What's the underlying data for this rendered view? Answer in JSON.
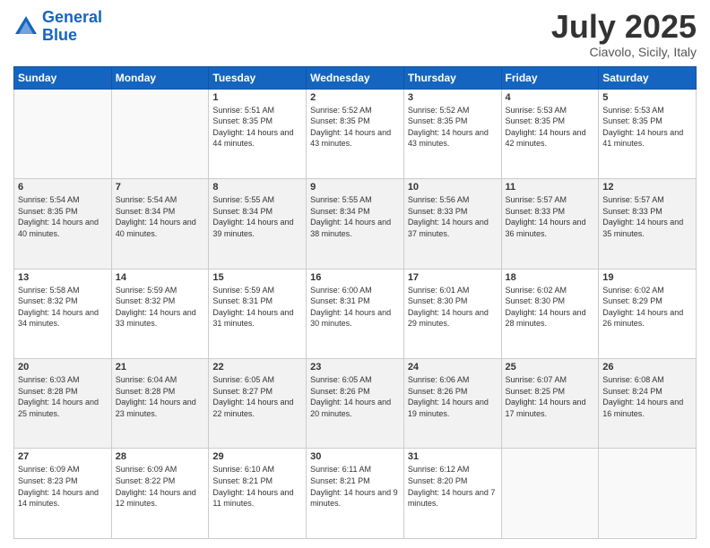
{
  "logo": {
    "line1": "General",
    "line2": "Blue"
  },
  "header": {
    "month": "July 2025",
    "location": "Ciavolo, Sicily, Italy"
  },
  "weekdays": [
    "Sunday",
    "Monday",
    "Tuesday",
    "Wednesday",
    "Thursday",
    "Friday",
    "Saturday"
  ],
  "weeks": [
    [
      {
        "day": "",
        "sunrise": "",
        "sunset": "",
        "daylight": ""
      },
      {
        "day": "",
        "sunrise": "",
        "sunset": "",
        "daylight": ""
      },
      {
        "day": "1",
        "sunrise": "Sunrise: 5:51 AM",
        "sunset": "Sunset: 8:35 PM",
        "daylight": "Daylight: 14 hours and 44 minutes."
      },
      {
        "day": "2",
        "sunrise": "Sunrise: 5:52 AM",
        "sunset": "Sunset: 8:35 PM",
        "daylight": "Daylight: 14 hours and 43 minutes."
      },
      {
        "day": "3",
        "sunrise": "Sunrise: 5:52 AM",
        "sunset": "Sunset: 8:35 PM",
        "daylight": "Daylight: 14 hours and 43 minutes."
      },
      {
        "day": "4",
        "sunrise": "Sunrise: 5:53 AM",
        "sunset": "Sunset: 8:35 PM",
        "daylight": "Daylight: 14 hours and 42 minutes."
      },
      {
        "day": "5",
        "sunrise": "Sunrise: 5:53 AM",
        "sunset": "Sunset: 8:35 PM",
        "daylight": "Daylight: 14 hours and 41 minutes."
      }
    ],
    [
      {
        "day": "6",
        "sunrise": "Sunrise: 5:54 AM",
        "sunset": "Sunset: 8:35 PM",
        "daylight": "Daylight: 14 hours and 40 minutes."
      },
      {
        "day": "7",
        "sunrise": "Sunrise: 5:54 AM",
        "sunset": "Sunset: 8:34 PM",
        "daylight": "Daylight: 14 hours and 40 minutes."
      },
      {
        "day": "8",
        "sunrise": "Sunrise: 5:55 AM",
        "sunset": "Sunset: 8:34 PM",
        "daylight": "Daylight: 14 hours and 39 minutes."
      },
      {
        "day": "9",
        "sunrise": "Sunrise: 5:55 AM",
        "sunset": "Sunset: 8:34 PM",
        "daylight": "Daylight: 14 hours and 38 minutes."
      },
      {
        "day": "10",
        "sunrise": "Sunrise: 5:56 AM",
        "sunset": "Sunset: 8:33 PM",
        "daylight": "Daylight: 14 hours and 37 minutes."
      },
      {
        "day": "11",
        "sunrise": "Sunrise: 5:57 AM",
        "sunset": "Sunset: 8:33 PM",
        "daylight": "Daylight: 14 hours and 36 minutes."
      },
      {
        "day": "12",
        "sunrise": "Sunrise: 5:57 AM",
        "sunset": "Sunset: 8:33 PM",
        "daylight": "Daylight: 14 hours and 35 minutes."
      }
    ],
    [
      {
        "day": "13",
        "sunrise": "Sunrise: 5:58 AM",
        "sunset": "Sunset: 8:32 PM",
        "daylight": "Daylight: 14 hours and 34 minutes."
      },
      {
        "day": "14",
        "sunrise": "Sunrise: 5:59 AM",
        "sunset": "Sunset: 8:32 PM",
        "daylight": "Daylight: 14 hours and 33 minutes."
      },
      {
        "day": "15",
        "sunrise": "Sunrise: 5:59 AM",
        "sunset": "Sunset: 8:31 PM",
        "daylight": "Daylight: 14 hours and 31 minutes."
      },
      {
        "day": "16",
        "sunrise": "Sunrise: 6:00 AM",
        "sunset": "Sunset: 8:31 PM",
        "daylight": "Daylight: 14 hours and 30 minutes."
      },
      {
        "day": "17",
        "sunrise": "Sunrise: 6:01 AM",
        "sunset": "Sunset: 8:30 PM",
        "daylight": "Daylight: 14 hours and 29 minutes."
      },
      {
        "day": "18",
        "sunrise": "Sunrise: 6:02 AM",
        "sunset": "Sunset: 8:30 PM",
        "daylight": "Daylight: 14 hours and 28 minutes."
      },
      {
        "day": "19",
        "sunrise": "Sunrise: 6:02 AM",
        "sunset": "Sunset: 8:29 PM",
        "daylight": "Daylight: 14 hours and 26 minutes."
      }
    ],
    [
      {
        "day": "20",
        "sunrise": "Sunrise: 6:03 AM",
        "sunset": "Sunset: 8:28 PM",
        "daylight": "Daylight: 14 hours and 25 minutes."
      },
      {
        "day": "21",
        "sunrise": "Sunrise: 6:04 AM",
        "sunset": "Sunset: 8:28 PM",
        "daylight": "Daylight: 14 hours and 23 minutes."
      },
      {
        "day": "22",
        "sunrise": "Sunrise: 6:05 AM",
        "sunset": "Sunset: 8:27 PM",
        "daylight": "Daylight: 14 hours and 22 minutes."
      },
      {
        "day": "23",
        "sunrise": "Sunrise: 6:05 AM",
        "sunset": "Sunset: 8:26 PM",
        "daylight": "Daylight: 14 hours and 20 minutes."
      },
      {
        "day": "24",
        "sunrise": "Sunrise: 6:06 AM",
        "sunset": "Sunset: 8:26 PM",
        "daylight": "Daylight: 14 hours and 19 minutes."
      },
      {
        "day": "25",
        "sunrise": "Sunrise: 6:07 AM",
        "sunset": "Sunset: 8:25 PM",
        "daylight": "Daylight: 14 hours and 17 minutes."
      },
      {
        "day": "26",
        "sunrise": "Sunrise: 6:08 AM",
        "sunset": "Sunset: 8:24 PM",
        "daylight": "Daylight: 14 hours and 16 minutes."
      }
    ],
    [
      {
        "day": "27",
        "sunrise": "Sunrise: 6:09 AM",
        "sunset": "Sunset: 8:23 PM",
        "daylight": "Daylight: 14 hours and 14 minutes."
      },
      {
        "day": "28",
        "sunrise": "Sunrise: 6:09 AM",
        "sunset": "Sunset: 8:22 PM",
        "daylight": "Daylight: 14 hours and 12 minutes."
      },
      {
        "day": "29",
        "sunrise": "Sunrise: 6:10 AM",
        "sunset": "Sunset: 8:21 PM",
        "daylight": "Daylight: 14 hours and 11 minutes."
      },
      {
        "day": "30",
        "sunrise": "Sunrise: 6:11 AM",
        "sunset": "Sunset: 8:21 PM",
        "daylight": "Daylight: 14 hours and 9 minutes."
      },
      {
        "day": "31",
        "sunrise": "Sunrise: 6:12 AM",
        "sunset": "Sunset: 8:20 PM",
        "daylight": "Daylight: 14 hours and 7 minutes."
      },
      {
        "day": "",
        "sunrise": "",
        "sunset": "",
        "daylight": ""
      },
      {
        "day": "",
        "sunrise": "",
        "sunset": "",
        "daylight": ""
      }
    ]
  ]
}
